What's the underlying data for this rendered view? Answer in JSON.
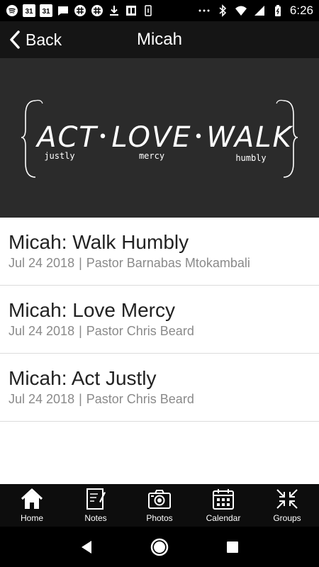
{
  "status_bar": {
    "time": "6:26",
    "calendar_day_1": "31",
    "calendar_day_2": "31"
  },
  "app_bar": {
    "back_label": "Back",
    "title": "Micah"
  },
  "banner": {
    "words": [
      "ACT",
      "LOVE",
      "WALK"
    ],
    "subwords": [
      "justly",
      "mercy",
      "humbly"
    ],
    "separator": "•"
  },
  "sermons": [
    {
      "title": "Micah: Walk Humbly",
      "date": "Jul 24 2018",
      "separator": "|",
      "speaker": "Pastor Barnabas Mtokambali"
    },
    {
      "title": "Micah: Love Mercy",
      "date": "Jul 24 2018",
      "separator": "|",
      "speaker": "Pastor Chris Beard"
    },
    {
      "title": "Micah: Act Justly",
      "date": "Jul 24 2018",
      "separator": "|",
      "speaker": "Pastor Chris Beard"
    }
  ],
  "tabs": [
    {
      "label": "Home",
      "icon": "home-icon"
    },
    {
      "label": "Notes",
      "icon": "notes-icon"
    },
    {
      "label": "Photos",
      "icon": "camera-icon"
    },
    {
      "label": "Calendar",
      "icon": "calendar-icon"
    },
    {
      "label": "Groups",
      "icon": "groups-icon"
    }
  ]
}
